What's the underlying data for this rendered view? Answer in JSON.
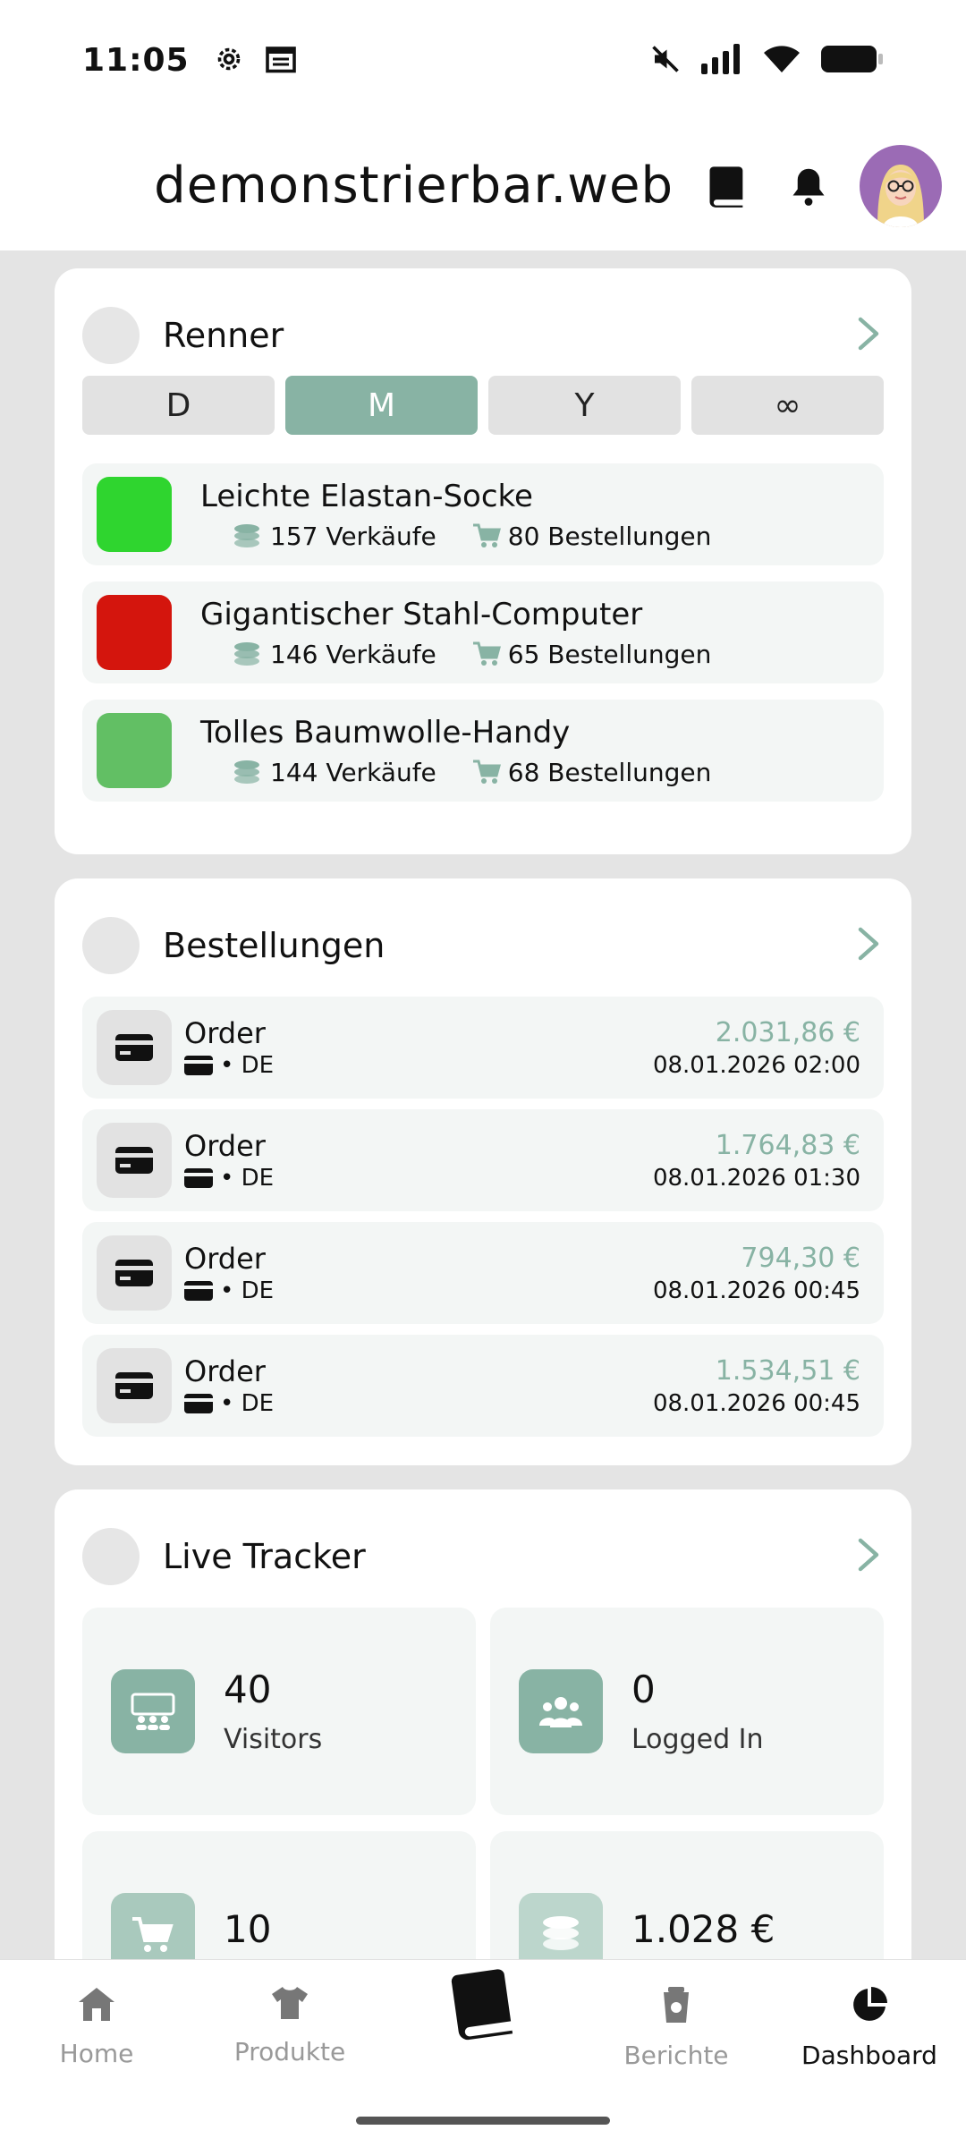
{
  "status_bar": {
    "time": "11:05",
    "icons": [
      "settings-icon",
      "calendar-icon",
      "mute-icon",
      "signal-icon",
      "wifi-icon",
      "battery-icon"
    ]
  },
  "header": {
    "title": "demonstrierbar.web",
    "icons": [
      "book-icon",
      "bell-icon",
      "avatar"
    ]
  },
  "renner": {
    "title": "Renner",
    "periods": [
      "D",
      "M",
      "Y",
      "∞"
    ],
    "active_period": "M",
    "items": [
      {
        "name": "Leichte Elastan-Socke",
        "sales": "157 Verkäufe",
        "orders": "80 Bestellungen",
        "color": "#2fd52f"
      },
      {
        "name": "Gigantischer Stahl-Computer",
        "sales": "146 Verkäufe",
        "orders": "65 Bestellungen",
        "color": "#d4150d"
      },
      {
        "name": "Tolles Baumwolle-Handy",
        "sales": "144 Verkäufe",
        "orders": "68 Bestellungen",
        "color": "#62bf64"
      }
    ]
  },
  "bestellungen": {
    "title": "Bestellungen",
    "items": [
      {
        "title": "Order",
        "country": "• DE",
        "amount": "2.031,86 €",
        "date": "08.01.2026 02:00"
      },
      {
        "title": "Order",
        "country": "• DE",
        "amount": "1.764,83 €",
        "date": "08.01.2026 01:30"
      },
      {
        "title": "Order",
        "country": "• DE",
        "amount": "794,30 €",
        "date": "08.01.2026 00:45"
      },
      {
        "title": "Order",
        "country": "• DE",
        "amount": "1.534,51 €",
        "date": "08.01.2026 00:45"
      }
    ]
  },
  "live_tracker": {
    "title": "Live Tracker",
    "tiles": [
      {
        "value": "40",
        "label": "Visitors",
        "icon": "visitors-icon"
      },
      {
        "value": "0",
        "label": "Logged In",
        "icon": "users-icon"
      },
      {
        "value": "10",
        "label": "",
        "icon": "cart-icon"
      },
      {
        "value": "1.028 €",
        "label": "",
        "icon": "coins-icon"
      }
    ]
  },
  "bottom_nav": {
    "items": [
      {
        "label": "Home",
        "icon": "home-icon"
      },
      {
        "label": "Produkte",
        "icon": "shirt-icon"
      },
      {
        "label": "",
        "icon": "book-icon"
      },
      {
        "label": "Berichte",
        "icon": "report-icon"
      },
      {
        "label": "Dashboard",
        "icon": "pie-chart-icon"
      }
    ],
    "active": "Dashboard"
  },
  "colors": {
    "accent": "#88b3a4",
    "background": "#e4e4e4",
    "item_bg": "#f3f6f5"
  }
}
